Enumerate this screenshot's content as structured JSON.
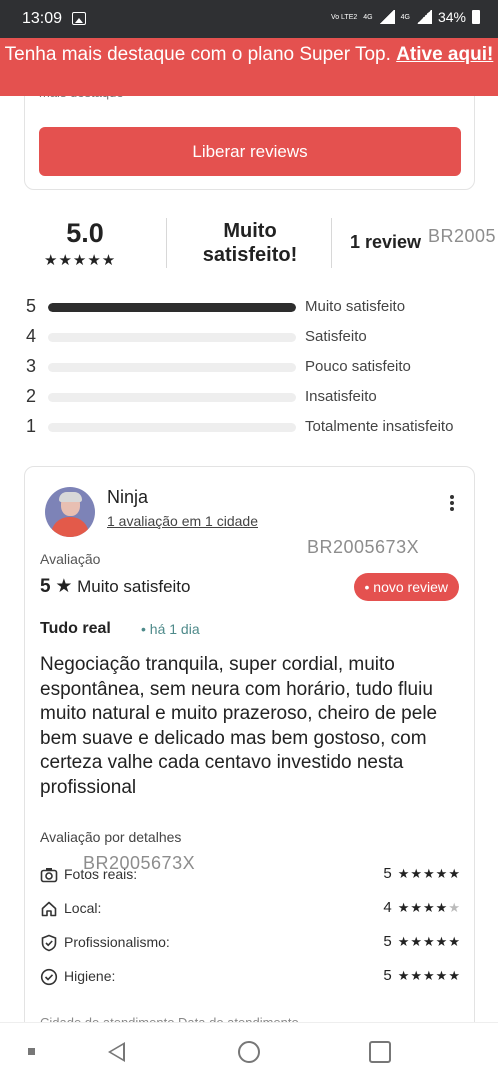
{
  "status_bar": {
    "time": "13:09",
    "battery": "34%",
    "volte": "Vo LTE2",
    "net_a": "4G",
    "net_b": "4G"
  },
  "promo": {
    "text": "Tenha mais destaque com o plano Super Top. ",
    "link": "Ative aqui!"
  },
  "top_card": {
    "cut_text": "mais destaque",
    "button": "Liberar reviews"
  },
  "summary": {
    "score": "5.0",
    "stars": "★★★★★",
    "satisfaction": "Muito satisfeito!",
    "count": "1 review"
  },
  "watermark": "BR2005673X",
  "watermark_cut": "BR2005",
  "distribution": [
    {
      "num": "5",
      "label": "Muito satisfeito",
      "fraction": 1.0
    },
    {
      "num": "4",
      "label": "Satisfeito",
      "fraction": 0.0
    },
    {
      "num": "3",
      "label": "Pouco satisfeito",
      "fraction": 0.0
    },
    {
      "num": "2",
      "label": "Insatisfeito",
      "fraction": 0.0
    },
    {
      "num": "1",
      "label": "Totalmente insatisfeito",
      "fraction": 0.0
    }
  ],
  "review": {
    "name": "Ninja",
    "subtitle": "1 avaliação em 1 cidade",
    "rating_label": "Avaliação",
    "rating_value": "5",
    "rating_star": "★",
    "rating_text": "Muito satisfeito",
    "badge": "• novo review",
    "title": "Tudo real",
    "time": "• há 1 dia",
    "text": "Negociação tranquila, super cordial, muito espontânea, sem neura com horário, tudo fluiu muito natural e muito prazeroso, cheiro de pele bem suave e delicado mas bem gostoso, com certeza valhe cada centavo investido nesta profissional",
    "details_title": "Avaliação por detalhes",
    "details": [
      {
        "label": "Fotos reais:",
        "value": "5",
        "stars_full": "★★★★★",
        "stars_empty": "",
        "icon": "camera-icon"
      },
      {
        "label": "Local:",
        "value": "4",
        "stars_full": "★★★★",
        "stars_empty": "★",
        "icon": "home-icon"
      },
      {
        "label": "Profissionalismo:",
        "value": "5",
        "stars_full": "★★★★★",
        "stars_empty": "",
        "icon": "shield-check-icon"
      },
      {
        "label": "Higiene:",
        "value": "5",
        "stars_full": "★★★★★",
        "stars_empty": "",
        "icon": "check-circle-icon"
      }
    ],
    "cut_bottom": "Cidade do atendimento     Data do atendimento"
  },
  "colors": {
    "accent": "#e4514f",
    "status_bar": "#2f3033",
    "bar_fill": "#2d2d2d",
    "bar_track": "#eeeeee"
  }
}
